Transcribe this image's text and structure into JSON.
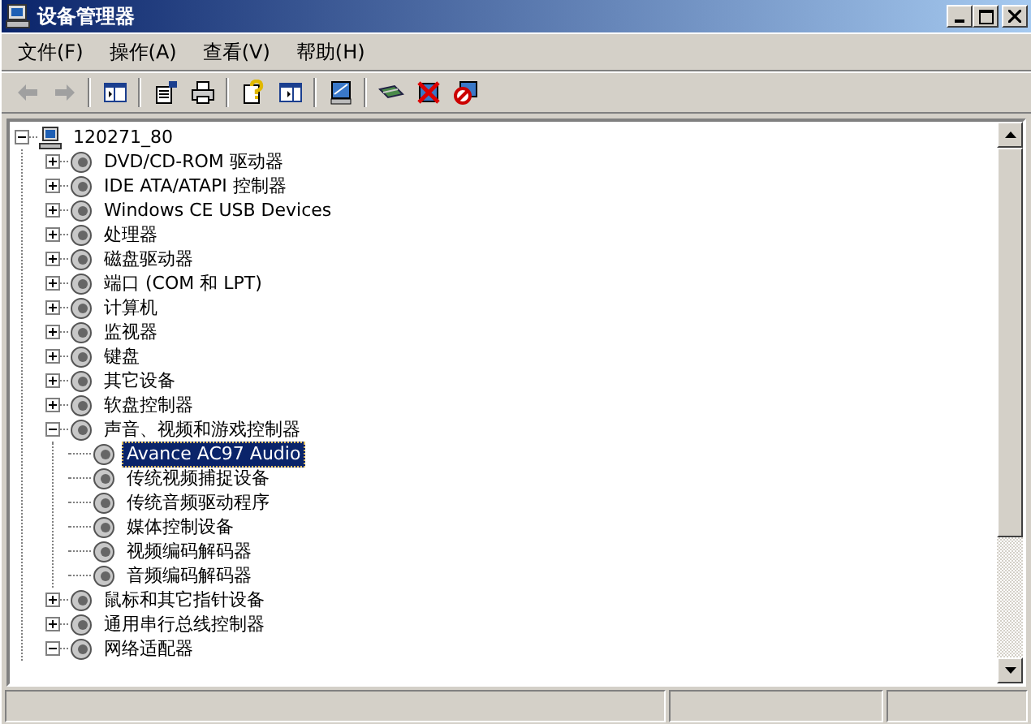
{
  "window": {
    "title": "设备管理器"
  },
  "menu": [
    "文件(F)",
    "操作(A)",
    "查看(V)",
    "帮助(H)"
  ],
  "toolbar": [
    {
      "kind": "back",
      "disabled": true
    },
    {
      "kind": "forward",
      "disabled": true
    },
    {
      "kind": "sep"
    },
    {
      "kind": "tree"
    },
    {
      "kind": "sep"
    },
    {
      "kind": "properties"
    },
    {
      "kind": "print"
    },
    {
      "kind": "sep"
    },
    {
      "kind": "help"
    },
    {
      "kind": "panel"
    },
    {
      "kind": "sep"
    },
    {
      "kind": "scan"
    },
    {
      "kind": "sep"
    },
    {
      "kind": "network"
    },
    {
      "kind": "uninstall"
    },
    {
      "kind": "disable"
    }
  ],
  "tree": {
    "label": "120271_80",
    "expanded": true,
    "selected": false,
    "children": [
      {
        "label": "DVD/CD-ROM 驱动器",
        "expanded": false,
        "selected": false
      },
      {
        "label": "IDE ATA/ATAPI 控制器",
        "expanded": false,
        "selected": false
      },
      {
        "label": "Windows CE USB Devices",
        "expanded": false,
        "selected": false
      },
      {
        "label": "处理器",
        "expanded": false,
        "selected": false
      },
      {
        "label": "磁盘驱动器",
        "expanded": false,
        "selected": false
      },
      {
        "label": "端口 (COM 和 LPT)",
        "expanded": false,
        "selected": false
      },
      {
        "label": "计算机",
        "expanded": false,
        "selected": false
      },
      {
        "label": "监视器",
        "expanded": false,
        "selected": false
      },
      {
        "label": "键盘",
        "expanded": false,
        "selected": false
      },
      {
        "label": "其它设备",
        "expanded": false,
        "selected": false
      },
      {
        "label": "软盘控制器",
        "expanded": false,
        "selected": false
      },
      {
        "label": "声音、视频和游戏控制器",
        "expanded": true,
        "selected": false,
        "children": [
          {
            "label": "Avance AC97 Audio",
            "selected": true
          },
          {
            "label": "传统视频捕捉设备",
            "selected": false
          },
          {
            "label": "传统音频驱动程序",
            "selected": false
          },
          {
            "label": "媒体控制设备",
            "selected": false
          },
          {
            "label": "视频编码解码器",
            "selected": false
          },
          {
            "label": "音频编码解码器",
            "selected": false
          }
        ]
      },
      {
        "label": "鼠标和其它指针设备",
        "expanded": false,
        "selected": false
      },
      {
        "label": "通用串行总线控制器",
        "expanded": false,
        "selected": false
      },
      {
        "label": "网络适配器",
        "expanded": true,
        "selected": false
      }
    ]
  }
}
